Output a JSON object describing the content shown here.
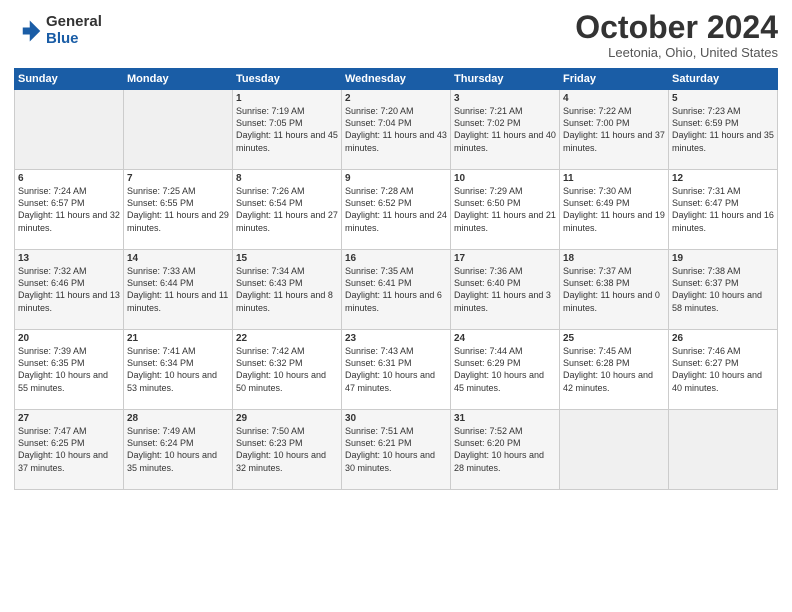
{
  "header": {
    "logo_general": "General",
    "logo_blue": "Blue",
    "title": "October 2024",
    "location": "Leetonia, Ohio, United States"
  },
  "days_of_week": [
    "Sunday",
    "Monday",
    "Tuesday",
    "Wednesday",
    "Thursday",
    "Friday",
    "Saturday"
  ],
  "weeks": [
    [
      {
        "day": "",
        "empty": true
      },
      {
        "day": "",
        "empty": true
      },
      {
        "day": "1",
        "sunrise": "7:19 AM",
        "sunset": "7:05 PM",
        "daylight": "11 hours and 45 minutes."
      },
      {
        "day": "2",
        "sunrise": "7:20 AM",
        "sunset": "7:04 PM",
        "daylight": "11 hours and 43 minutes."
      },
      {
        "day": "3",
        "sunrise": "7:21 AM",
        "sunset": "7:02 PM",
        "daylight": "11 hours and 40 minutes."
      },
      {
        "day": "4",
        "sunrise": "7:22 AM",
        "sunset": "7:00 PM",
        "daylight": "11 hours and 37 minutes."
      },
      {
        "day": "5",
        "sunrise": "7:23 AM",
        "sunset": "6:59 PM",
        "daylight": "11 hours and 35 minutes."
      }
    ],
    [
      {
        "day": "6",
        "sunrise": "7:24 AM",
        "sunset": "6:57 PM",
        "daylight": "11 hours and 32 minutes."
      },
      {
        "day": "7",
        "sunrise": "7:25 AM",
        "sunset": "6:55 PM",
        "daylight": "11 hours and 29 minutes."
      },
      {
        "day": "8",
        "sunrise": "7:26 AM",
        "sunset": "6:54 PM",
        "daylight": "11 hours and 27 minutes."
      },
      {
        "day": "9",
        "sunrise": "7:28 AM",
        "sunset": "6:52 PM",
        "daylight": "11 hours and 24 minutes."
      },
      {
        "day": "10",
        "sunrise": "7:29 AM",
        "sunset": "6:50 PM",
        "daylight": "11 hours and 21 minutes."
      },
      {
        "day": "11",
        "sunrise": "7:30 AM",
        "sunset": "6:49 PM",
        "daylight": "11 hours and 19 minutes."
      },
      {
        "day": "12",
        "sunrise": "7:31 AM",
        "sunset": "6:47 PM",
        "daylight": "11 hours and 16 minutes."
      }
    ],
    [
      {
        "day": "13",
        "sunrise": "7:32 AM",
        "sunset": "6:46 PM",
        "daylight": "11 hours and 13 minutes."
      },
      {
        "day": "14",
        "sunrise": "7:33 AM",
        "sunset": "6:44 PM",
        "daylight": "11 hours and 11 minutes."
      },
      {
        "day": "15",
        "sunrise": "7:34 AM",
        "sunset": "6:43 PM",
        "daylight": "11 hours and 8 minutes."
      },
      {
        "day": "16",
        "sunrise": "7:35 AM",
        "sunset": "6:41 PM",
        "daylight": "11 hours and 6 minutes."
      },
      {
        "day": "17",
        "sunrise": "7:36 AM",
        "sunset": "6:40 PM",
        "daylight": "11 hours and 3 minutes."
      },
      {
        "day": "18",
        "sunrise": "7:37 AM",
        "sunset": "6:38 PM",
        "daylight": "11 hours and 0 minutes."
      },
      {
        "day": "19",
        "sunrise": "7:38 AM",
        "sunset": "6:37 PM",
        "daylight": "10 hours and 58 minutes."
      }
    ],
    [
      {
        "day": "20",
        "sunrise": "7:39 AM",
        "sunset": "6:35 PM",
        "daylight": "10 hours and 55 minutes."
      },
      {
        "day": "21",
        "sunrise": "7:41 AM",
        "sunset": "6:34 PM",
        "daylight": "10 hours and 53 minutes."
      },
      {
        "day": "22",
        "sunrise": "7:42 AM",
        "sunset": "6:32 PM",
        "daylight": "10 hours and 50 minutes."
      },
      {
        "day": "23",
        "sunrise": "7:43 AM",
        "sunset": "6:31 PM",
        "daylight": "10 hours and 47 minutes."
      },
      {
        "day": "24",
        "sunrise": "7:44 AM",
        "sunset": "6:29 PM",
        "daylight": "10 hours and 45 minutes."
      },
      {
        "day": "25",
        "sunrise": "7:45 AM",
        "sunset": "6:28 PM",
        "daylight": "10 hours and 42 minutes."
      },
      {
        "day": "26",
        "sunrise": "7:46 AM",
        "sunset": "6:27 PM",
        "daylight": "10 hours and 40 minutes."
      }
    ],
    [
      {
        "day": "27",
        "sunrise": "7:47 AM",
        "sunset": "6:25 PM",
        "daylight": "10 hours and 37 minutes."
      },
      {
        "day": "28",
        "sunrise": "7:49 AM",
        "sunset": "6:24 PM",
        "daylight": "10 hours and 35 minutes."
      },
      {
        "day": "29",
        "sunrise": "7:50 AM",
        "sunset": "6:23 PM",
        "daylight": "10 hours and 32 minutes."
      },
      {
        "day": "30",
        "sunrise": "7:51 AM",
        "sunset": "6:21 PM",
        "daylight": "10 hours and 30 minutes."
      },
      {
        "day": "31",
        "sunrise": "7:52 AM",
        "sunset": "6:20 PM",
        "daylight": "10 hours and 28 minutes."
      },
      {
        "day": "",
        "empty": true
      },
      {
        "day": "",
        "empty": true
      }
    ]
  ],
  "labels": {
    "sunrise": "Sunrise:",
    "sunset": "Sunset:",
    "daylight": "Daylight:"
  }
}
